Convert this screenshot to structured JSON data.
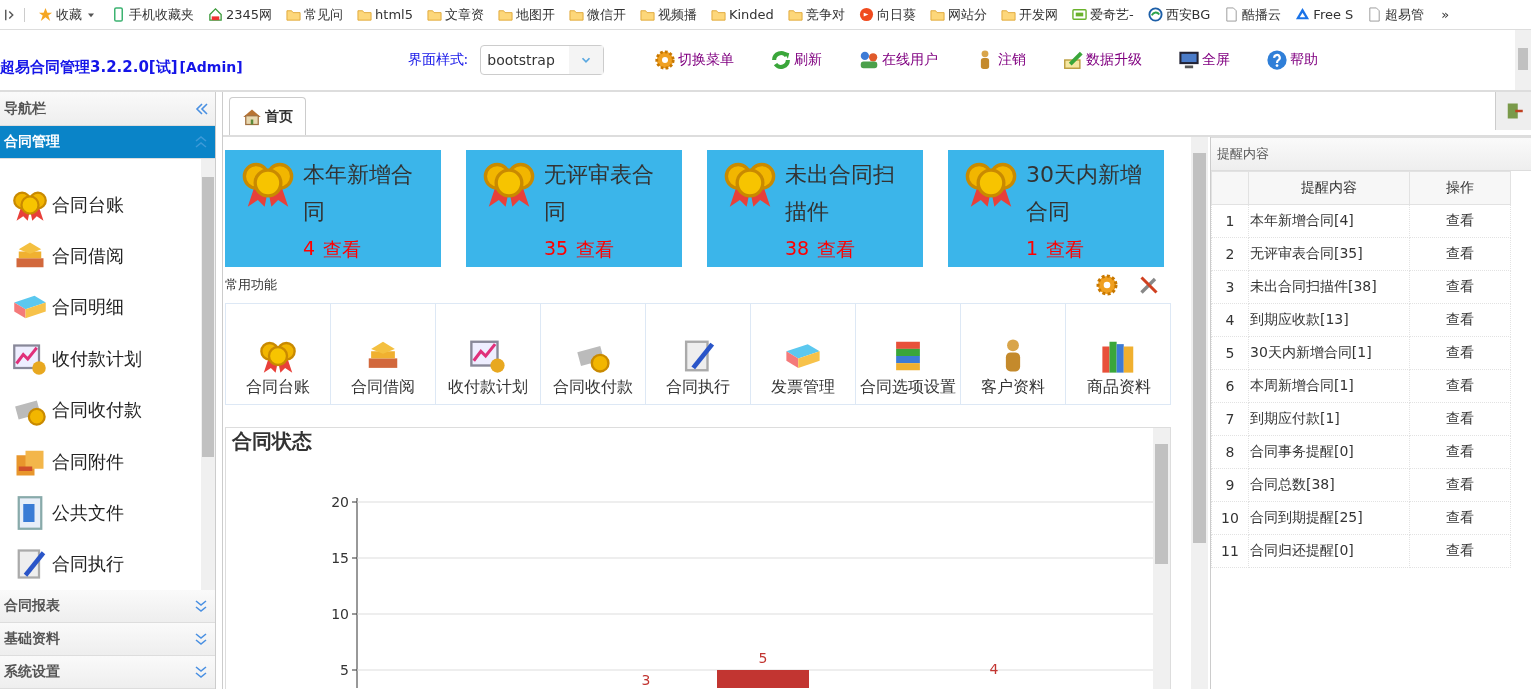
{
  "bookmarks": [
    {
      "kind": "star",
      "label": "收藏",
      "menu": true
    },
    {
      "kind": "phone",
      "label": "手机收藏夹"
    },
    {
      "kind": "house",
      "label": "2345网"
    },
    {
      "kind": "folder",
      "label": "常见问"
    },
    {
      "kind": "folder",
      "label": "html5"
    },
    {
      "kind": "folder",
      "label": "文章资"
    },
    {
      "kind": "folder",
      "label": "地图开"
    },
    {
      "kind": "folder",
      "label": "微信开"
    },
    {
      "kind": "folder",
      "label": "视频播"
    },
    {
      "kind": "folder",
      "label": "Kinded"
    },
    {
      "kind": "folder",
      "label": "竞争对"
    },
    {
      "kind": "orange",
      "label": "向日葵"
    },
    {
      "kind": "folder",
      "label": "网站分"
    },
    {
      "kind": "folder",
      "label": "开发网"
    },
    {
      "kind": "green",
      "label": "爱奇艺-"
    },
    {
      "kind": "swirl",
      "label": "西安BG"
    },
    {
      "kind": "page",
      "label": "酷播云"
    },
    {
      "kind": "blue",
      "label": "Free S"
    },
    {
      "kind": "page",
      "label": "超易管"
    }
  ],
  "bookmarks_more": "»",
  "app": {
    "title": "超易合同管理3.2.2.0[试]",
    "user": "[Admin]",
    "style_label": "界面样式:",
    "style_value": "bootstrap"
  },
  "toolbar": [
    {
      "kind": "gear",
      "label": "切换菜单"
    },
    {
      "kind": "refresh",
      "label": "刷新"
    },
    {
      "kind": "users",
      "label": "在线用户"
    },
    {
      "kind": "person",
      "label": "注销"
    },
    {
      "kind": "pencil",
      "label": "数据升级"
    },
    {
      "kind": "monitor",
      "label": "全屏"
    },
    {
      "kind": "help",
      "label": "帮助"
    }
  ],
  "sidebar": {
    "title": "导航栏",
    "groups": [
      {
        "label": "合同管理",
        "expanded": true,
        "items": [
          {
            "kind": "medal",
            "label": "合同台账"
          },
          {
            "kind": "books",
            "label": "合同借阅"
          },
          {
            "kind": "layers",
            "label": "合同明细"
          },
          {
            "kind": "chart",
            "label": "收付款计划"
          },
          {
            "kind": "coins",
            "label": "合同收付款"
          },
          {
            "kind": "box",
            "label": "合同附件"
          },
          {
            "kind": "doc",
            "label": "公共文件"
          },
          {
            "kind": "scroll",
            "label": "合同执行"
          }
        ]
      },
      {
        "label": "合同报表",
        "expanded": false
      },
      {
        "label": "基础资料",
        "expanded": false
      },
      {
        "label": "系统设置",
        "expanded": false
      }
    ]
  },
  "tabs": [
    {
      "label": "首页",
      "selected": true
    }
  ],
  "stat_cards": [
    {
      "title": "本年新增合同",
      "count": "4",
      "link": "查看"
    },
    {
      "title": "无评审表合同",
      "count": "35",
      "link": "查看"
    },
    {
      "title": "未出合同扫描件",
      "count": "38",
      "link": "查看"
    },
    {
      "title": "30天内新增合同",
      "count": "1",
      "link": "查看"
    }
  ],
  "functions": {
    "title": "常用功能",
    "items": [
      {
        "kind": "medal",
        "label": "合同台账"
      },
      {
        "kind": "books",
        "label": "合同借阅"
      },
      {
        "kind": "chart",
        "label": "收付款计划"
      },
      {
        "kind": "coins",
        "label": "合同收付款"
      },
      {
        "kind": "scroll",
        "label": "合同执行"
      },
      {
        "kind": "layers",
        "label": "发票管理"
      },
      {
        "kind": "stack",
        "label": "合同选项设置"
      },
      {
        "kind": "person",
        "label": "客户资料"
      },
      {
        "kind": "bookshelf",
        "label": "商品资料"
      }
    ]
  },
  "chart": {
    "title": "合同状态",
    "y_axis_labels": [
      "20",
      "15",
      "10",
      "5"
    ],
    "bar_labels": [
      "3",
      "5",
      "4"
    ]
  },
  "reminders": {
    "title": "提醒内容",
    "columns": [
      "提醒内容",
      "操作"
    ],
    "rows": [
      {
        "index": "1",
        "text": "本年新增合同[4]",
        "action": "查看"
      },
      {
        "index": "2",
        "text": "无评审表合同[35]",
        "action": "查看"
      },
      {
        "index": "3",
        "text": "未出合同扫描件[38]",
        "action": "查看"
      },
      {
        "index": "4",
        "text": "到期应收款[13]",
        "action": "查看"
      },
      {
        "index": "5",
        "text": "30天内新增合同[1]",
        "action": "查看"
      },
      {
        "index": "6",
        "text": "本周新增合同[1]",
        "action": "查看"
      },
      {
        "index": "7",
        "text": "到期应付款[1]",
        "action": "查看"
      },
      {
        "index": "8",
        "text": "合同事务提醒[0]",
        "action": "查看"
      },
      {
        "index": "9",
        "text": "合同总数[38]",
        "action": "查看"
      },
      {
        "index": "10",
        "text": "合同到期提醒[25]",
        "action": "查看"
      },
      {
        "index": "11",
        "text": "合同归还提醒[0]",
        "action": "查看"
      }
    ]
  }
}
